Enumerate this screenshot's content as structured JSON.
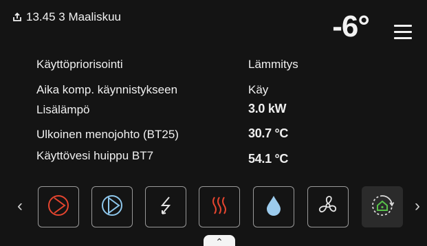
{
  "header": {
    "datetime": "13.45 3 Maaliskuu",
    "outdoor_temp": "-6°",
    "status_icon": "export-icon",
    "menu_icon": "hamburger-menu-icon"
  },
  "info_rows": [
    {
      "label": "Käyttöpriorisointi",
      "value": "Lämmitys"
    },
    {
      "label": "Aika komp. käynnistykseen",
      "value": "Käy"
    },
    {
      "label": "Lisälämpö",
      "value": "3.0 kW"
    },
    {
      "label": "Ulkoinen menojohto (BT25)",
      "value": "30.7 °C"
    },
    {
      "label": "Käyttövesi huippu BT7",
      "value": "54.1 °C"
    }
  ],
  "carousel": {
    "prev_label": "‹",
    "next_label": "›",
    "tiles": [
      {
        "icon": "compressor-icon",
        "color": "#e5452f"
      },
      {
        "icon": "circulation-pump-icon",
        "color": "#8ec7ec"
      },
      {
        "icon": "electric-power-icon",
        "color": "#e6e6e6"
      },
      {
        "icon": "additional-heat-icon",
        "color": "#e5452f"
      },
      {
        "icon": "hot-water-drop-icon",
        "color": "#9ccbed"
      },
      {
        "icon": "ventilation-fan-icon",
        "color": "#e6e6e6"
      },
      {
        "icon": "home-cycle-icon",
        "color": "#58c24a"
      }
    ]
  },
  "bottom_tab": {
    "label": "⌃"
  }
}
